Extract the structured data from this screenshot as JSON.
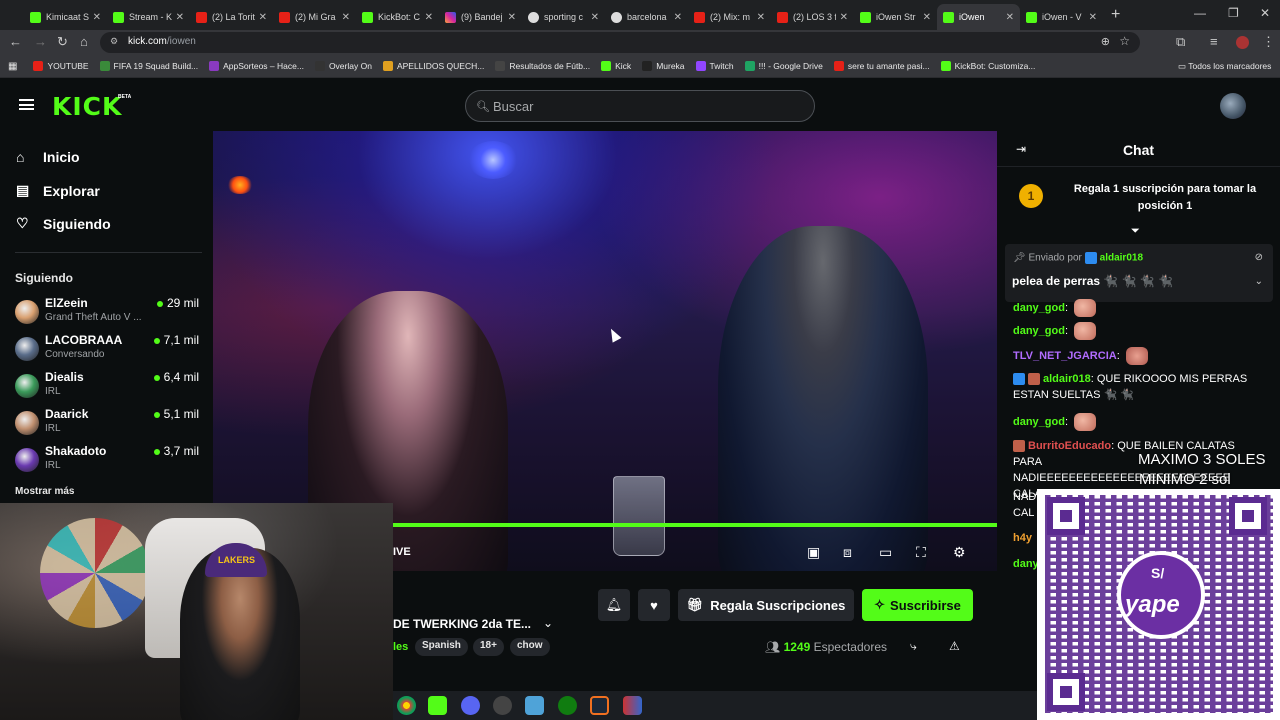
{
  "browser": {
    "tabs": [
      {
        "label": "Kimicaat S",
        "icon": "kick",
        "close": "✕"
      },
      {
        "label": "Stream - K",
        "icon": "kick",
        "close": "✕"
      },
      {
        "label": "(2) La Torit",
        "icon": "youtube",
        "close": "✕"
      },
      {
        "label": "(2) Mi Gra",
        "icon": "youtube",
        "close": "✕"
      },
      {
        "label": "KickBot: C",
        "icon": "kick",
        "close": "✕"
      },
      {
        "label": "(9) Bandej",
        "icon": "instagram",
        "close": "✕"
      },
      {
        "label": "sporting c",
        "icon": "globe",
        "close": "✕"
      },
      {
        "label": "barcelona",
        "icon": "globe",
        "close": "✕"
      },
      {
        "label": "(2) Mix: m",
        "icon": "youtube",
        "close": "✕"
      },
      {
        "label": "(2) LOS 3 f",
        "icon": "youtube",
        "close": "✕"
      },
      {
        "label": "iOwen Str",
        "icon": "kick",
        "close": "✕"
      },
      {
        "label": "iOwen",
        "icon": "kick",
        "close": "✕",
        "active": true
      },
      {
        "label": "iOwen - V",
        "icon": "kick",
        "close": "✕"
      }
    ],
    "new_tab": "+",
    "url_host": "kick.com",
    "url_path": "/iowen",
    "bookmarks": [
      {
        "label": "YOUTUBE",
        "color": "#e62117"
      },
      {
        "label": "FIFA 19 Squad Build...",
        "color": "#3a8a3a"
      },
      {
        "label": "AppSorteos – Hace...",
        "color": "#8a3ac0"
      },
      {
        "label": "Overlay On",
        "color": "#333333"
      },
      {
        "label": "APELLIDOS QUECH...",
        "color": "#e0a020"
      },
      {
        "label": "Resultados de Fútb...",
        "color": "#444444"
      },
      {
        "label": "Kick",
        "color": "#53fc18"
      },
      {
        "label": "Mureka",
        "color": "#222222"
      },
      {
        "label": "Twitch",
        "color": "#9146ff"
      },
      {
        "label": "!!! - Google Drive",
        "color": "#1fa463"
      },
      {
        "label": "sere tu amante pasi...",
        "color": "#e62117"
      },
      {
        "label": "KickBot: Customiza...",
        "color": "#53fc18"
      }
    ],
    "all_bookmarks": "Todos los marcadores"
  },
  "header": {
    "logo": "KICK",
    "beta": "BETA",
    "search_placeholder": "Buscar"
  },
  "sidebar": {
    "nav": [
      {
        "label": "Inicio",
        "icon": "home-icon"
      },
      {
        "label": "Explorar",
        "icon": "explore-icon"
      },
      {
        "label": "Siguiendo",
        "icon": "heart-icon"
      }
    ],
    "following_title": "Siguiendo",
    "channels": [
      {
        "name": "ElZeein",
        "category": "Grand Theft Auto V ...",
        "viewers": "29 mil",
        "color": "#d9a070"
      },
      {
        "name": "LACOBRAAA",
        "category": "Conversando",
        "viewers": "7,1 mil",
        "color": "#5a6d8a"
      },
      {
        "name": "Diealis",
        "category": "IRL",
        "viewers": "6,4 mil",
        "color": "#3a9a5a"
      },
      {
        "name": "Daarick",
        "category": "IRL",
        "viewers": "5,1 mil",
        "color": "#c09070"
      },
      {
        "name": "Shakadoto",
        "category": "IRL",
        "viewers": "3,7 mil",
        "color": "#6a3ab0"
      }
    ],
    "show_more": "Mostrar más"
  },
  "player": {
    "live_label": "IVE",
    "progress_fraction": 1.0
  },
  "stream": {
    "title": "DE TWERKING 2da TE...",
    "category": "les",
    "tags": [
      "Spanish",
      "18+",
      "chow"
    ],
    "gift_label": "Regala Suscripciones",
    "subscribe_label": "Suscribirse",
    "viewers": "1249",
    "viewers_label": "Espectadores"
  },
  "chat": {
    "title": "Chat",
    "gift_promo": "Regala 1 suscripción para tomar la posición 1",
    "gift_rank": "1",
    "pinned_sent_by": "Enviado por",
    "pinned_user": "aldair018",
    "pinned_message": "pelea de perras 🐈‍⬛ 🐈‍⬛ 🐈‍⬛ 🐈‍⬛",
    "messages": [
      {
        "user": "dany_god",
        "text": "",
        "user_color": "#53fc18"
      },
      {
        "user": "TLV_NET_JGARCIA",
        "text": "",
        "user_color": "#b16cff"
      },
      {
        "user": "aldair018",
        "text": "QUE RIKOOOO MIS PERRAS ESTAN SUELTAS 🐈‍⬛ 🐈‍⬛",
        "user_color": "#53fc18"
      },
      {
        "user": "dany_god",
        "text": "",
        "user_color": "#53fc18"
      },
      {
        "user": "BurritoEducado",
        "text": "QUE BAILEN CALATAS PARA NADIEEEEEEEEEEEEEEEEEEEEEEEEEE CALATAS PARA",
        "user_color": "#e05050"
      }
    ],
    "partial_lines": [
      "NAD",
      "CAL",
      "h4y",
      "dany"
    ]
  },
  "overlay": {
    "max_label": "MAXIMO 3 SOLES",
    "min_label": "MINIMO 2 sol",
    "currency_symbol": "S/",
    "brand": "yape",
    "cap_text": "LAKERS"
  }
}
